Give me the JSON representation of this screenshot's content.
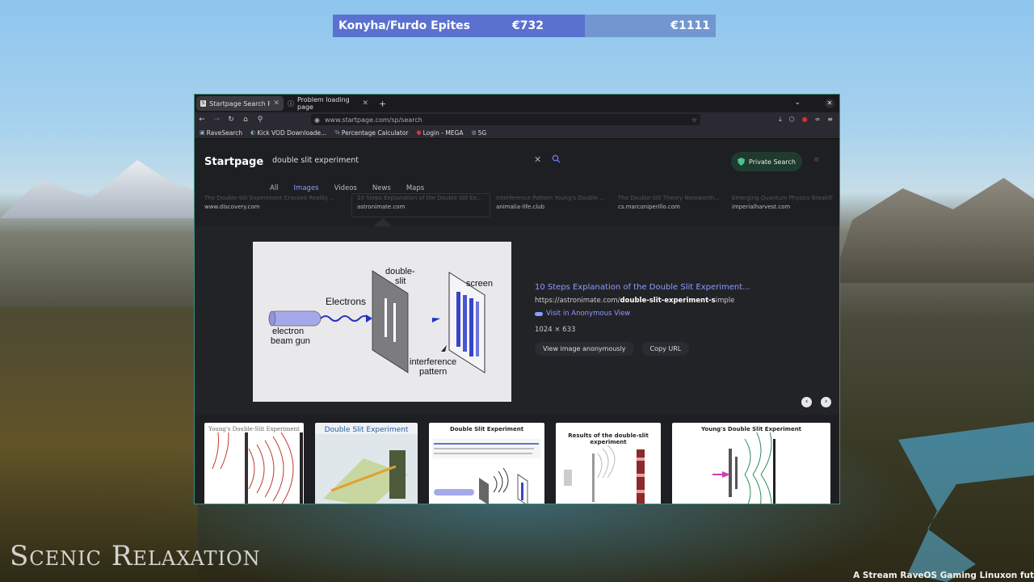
{
  "overlay": {
    "title": "Konyha/Furdo Epites",
    "value_current": "€732",
    "value_target": "€1111",
    "progress": 0.659,
    "fill_color": "#5b71cf"
  },
  "browser": {
    "tabs": [
      {
        "label": "Startpage Search Results",
        "icon": "startpage-favicon",
        "active": true
      },
      {
        "label": "Problem loading page",
        "icon": "info-icon",
        "active": false
      }
    ],
    "url": "www.startpage.com/sp/search",
    "bookmarks": [
      {
        "label": "RaveSearch",
        "icon": "bookmark-icon"
      },
      {
        "label": "Kick VOD Downloade...",
        "icon": "bookmark-icon"
      },
      {
        "label": "Percentage Calculator",
        "icon": "percent-icon"
      },
      {
        "label": "Login - MEGA",
        "icon": "mega-icon"
      },
      {
        "label": "5G",
        "icon": "globe-icon"
      }
    ]
  },
  "startpage": {
    "logo": "Startpage",
    "query": "double slit experiment",
    "private_label": "Private Search",
    "categories": [
      "All",
      "Images",
      "Videos",
      "News",
      "Maps"
    ],
    "active_category": "Images",
    "strip": [
      {
        "title": "The Double-Slit Experiment Cracked Reality ...",
        "source": "www.discovery.com"
      },
      {
        "title": "10 Steps Explanation of the Double Slit Ex...",
        "source": "astronimate.com"
      },
      {
        "title": "Interference Pattern Young's Double ...",
        "source": "animalia-life.club"
      },
      {
        "title": "The Double-Slit Theory Noteworth...",
        "source": "cs.marconiperillo.com"
      },
      {
        "title": "Emerging Quantum Physics Breakth...",
        "source": "imperialharvest.com"
      }
    ],
    "detail": {
      "title": "10 Steps Explanation of the Double Slit Experiment...",
      "url_prefix": "https://astronimate.com/",
      "url_bold": "double-slit-experiment-s",
      "url_suffix": "imple",
      "anon_link": "Visit in Anonymous View",
      "dimensions": "1024 × 633",
      "view_anon": "View image anonymously",
      "copy_url": "Copy URL"
    },
    "preview_labels": {
      "electrons": "Electrons",
      "gun": "electron beam gun",
      "gun_line1": "electron",
      "gun_line2": "beam gun",
      "slit1": "double-",
      "slit2": "slit",
      "screen": "screen",
      "interf1": "interference",
      "interf2": "pattern"
    },
    "thumbnails": [
      {
        "title": "Young's Double-Slit Experiment"
      },
      {
        "title": "Double Slit Experiment"
      },
      {
        "title": "Double Slit Experiment"
      },
      {
        "title": "Results of the double-slit experiment"
      },
      {
        "title": "Young's Double Slit Experiment"
      }
    ]
  },
  "stream": {
    "watermark_main": "Scenic Relaxation",
    "ticker": "A Stream RaveOS Gaming Linuxon fut"
  }
}
